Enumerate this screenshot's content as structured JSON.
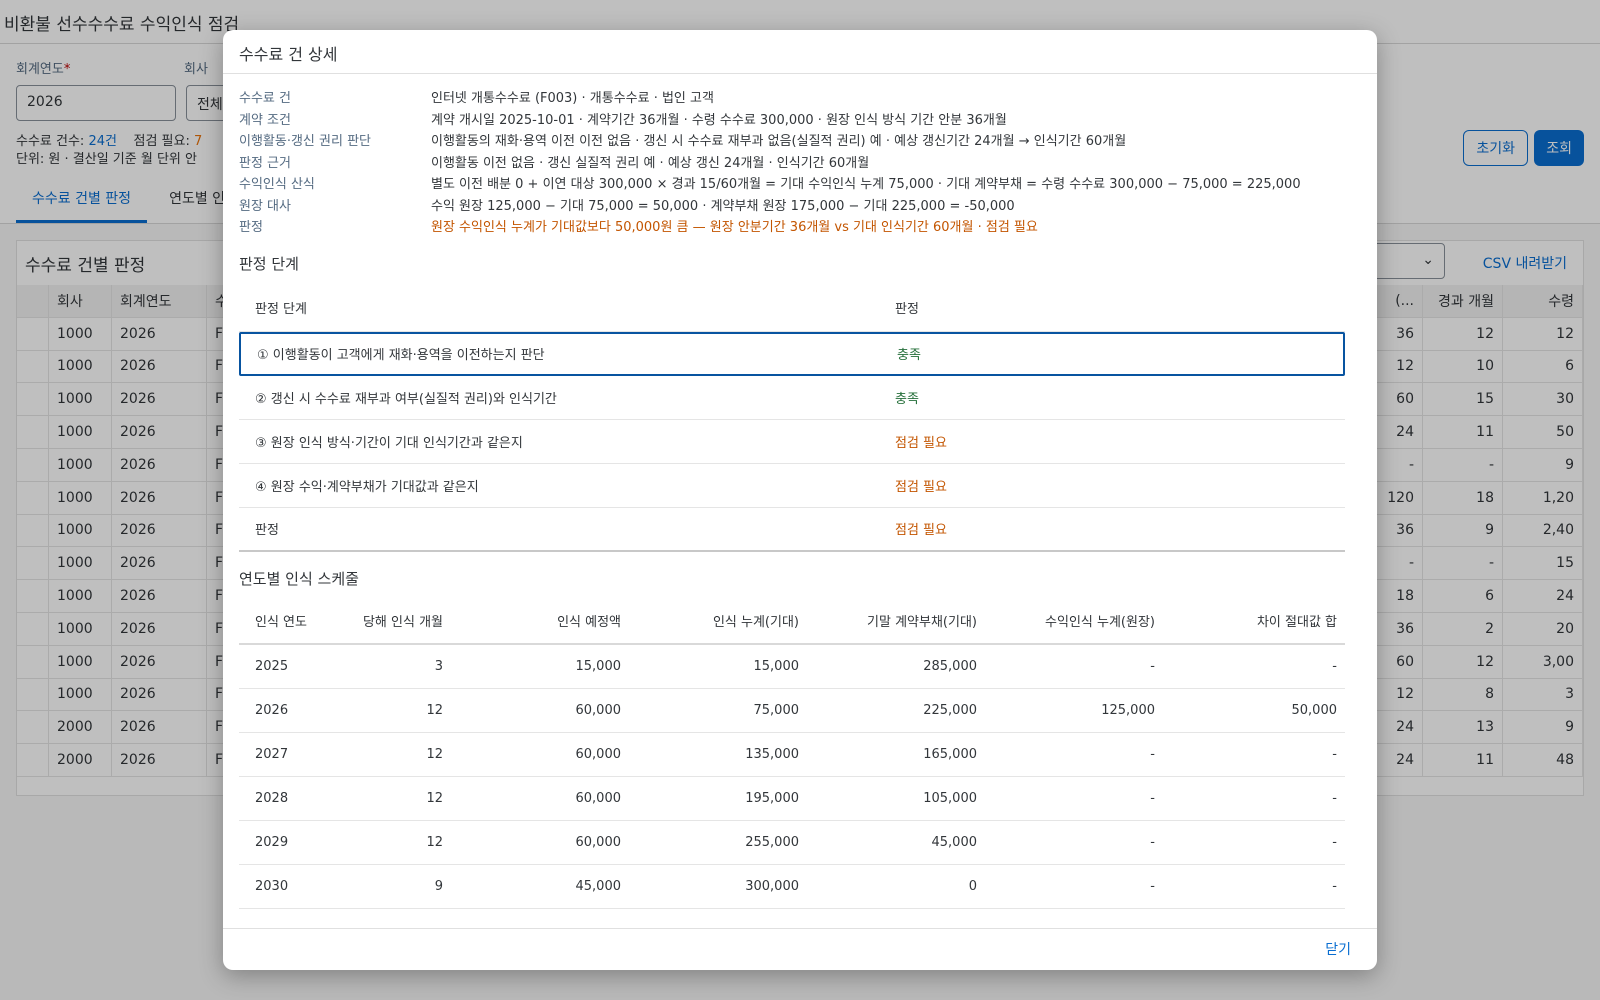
{
  "page": {
    "title": "비환불 선수수수료 수익인식 점검",
    "filters": {
      "fiscal_year_label": "회계연도",
      "required_mark": "*",
      "fiscal_year_value": "2026",
      "company_label": "회사",
      "company_value": "전체"
    },
    "summary": {
      "count_label": "수수료 건수:",
      "count_value": "24건",
      "check_label": "점검 필요:",
      "check_value": "7",
      "unit_note": "단위: 원 · 결산일 기준 월 단위 안"
    },
    "buttons": {
      "reset": "초기화",
      "search": "조회"
    },
    "tabs": [
      {
        "label": "수수료 건별 판정"
      },
      {
        "label": "연도별 인"
      }
    ],
    "panel": {
      "title": "수수료 건별 판정",
      "csv": "CSV 내려받기",
      "columns": {
        "company": "회사",
        "fiscal_year": "회계연도",
        "fee": "수",
        "period": "(...",
        "elapsed": "경과 개월",
        "received": "수령"
      },
      "rows": [
        {
          "company": "1000",
          "fy": "2026",
          "f": "F",
          "p": "36",
          "e": "12",
          "r": "12"
        },
        {
          "company": "1000",
          "fy": "2026",
          "f": "F",
          "p": "12",
          "e": "10",
          "r": "6"
        },
        {
          "company": "1000",
          "fy": "2026",
          "f": "F",
          "p": "60",
          "e": "15",
          "r": "30"
        },
        {
          "company": "1000",
          "fy": "2026",
          "f": "F",
          "p": "24",
          "e": "11",
          "r": "50"
        },
        {
          "company": "1000",
          "fy": "2026",
          "f": "F",
          "p": "-",
          "e": "-",
          "r": "9"
        },
        {
          "company": "1000",
          "fy": "2026",
          "f": "F",
          "p": "120",
          "e": "18",
          "r": "1,20"
        },
        {
          "company": "1000",
          "fy": "2026",
          "f": "F",
          "p": "36",
          "e": "9",
          "r": "2,40"
        },
        {
          "company": "1000",
          "fy": "2026",
          "f": "F",
          "p": "-",
          "e": "-",
          "r": "15"
        },
        {
          "company": "1000",
          "fy": "2026",
          "f": "F",
          "p": "18",
          "e": "6",
          "r": "24"
        },
        {
          "company": "1000",
          "fy": "2026",
          "f": "F",
          "p": "36",
          "e": "2",
          "r": "20"
        },
        {
          "company": "1000",
          "fy": "2026",
          "f": "F",
          "p": "60",
          "e": "12",
          "r": "3,00"
        },
        {
          "company": "1000",
          "fy": "2026",
          "f": "F",
          "p": "12",
          "e": "8",
          "r": "3"
        },
        {
          "company": "2000",
          "fy": "2026",
          "f": "F",
          "p": "24",
          "e": "13",
          "r": "9"
        },
        {
          "company": "2000",
          "fy": "2026",
          "f": "F",
          "p": "24",
          "e": "11",
          "r": "48"
        }
      ]
    }
  },
  "dialog": {
    "title": "수수료 건 상세",
    "info": [
      {
        "key": "수수료 건",
        "value": "인터넷 개통수수료 (F003) · 개통수수료 · 법인 고객",
        "tone": "normal"
      },
      {
        "key": "계약 조건",
        "value": "계약 개시일 2025-10-01 · 계약기간 36개월 · 수령 수수료 300,000 · 원장 인식 방식 기간 안분 36개월",
        "tone": "normal"
      },
      {
        "key": "이행활동·갱신 권리 판단",
        "value": "이행활동의 재화·용역 이전 이전 없음 · 갱신 시 수수료 재부과 없음(실질적 권리) 예 · 예상 갱신기간 24개월 → 인식기간 60개월",
        "tone": "normal"
      },
      {
        "key": "판정 근거",
        "value": "이행활동 이전 없음 · 갱신 실질적 권리 예 · 예상 갱신 24개월 · 인식기간 60개월",
        "tone": "normal"
      },
      {
        "key": "수익인식 산식",
        "value": "별도 이전 배분 0 + 이연 대상 300,000 × 경과 15/60개월 = 기대 수익인식 누계 75,000 · 기대 계약부채 = 수령 수수료 300,000 − 75,000 = 225,000",
        "tone": "normal"
      },
      {
        "key": "원장 대사",
        "value": "수익 원장 125,000 − 기대 75,000 = 50,000 · 계약부채 원장 175,000 − 기대 225,000 = -50,000",
        "tone": "normal"
      },
      {
        "key": "판정",
        "value": "원장 수익인식 누계가 기대값보다 50,000원 큼 — 원장 안분기간 36개월 vs 기대 인식기간 60개월 · 점검 필요",
        "tone": "warn"
      }
    ],
    "steps_title": "판정 단계",
    "steps_header": {
      "step": "판정 단계",
      "result": "판정"
    },
    "steps": [
      {
        "step": "① 이행활동이 고객에게 재화·용역을 이전하는지 판단",
        "result": "충족",
        "status": "ok"
      },
      {
        "step": "② 갱신 시 수수료 재부과 여부(실질적 권리)와 인식기간",
        "result": "충족",
        "status": "ok"
      },
      {
        "step": "③ 원장 인식 방식·기간이 기대 인식기간과 같은지",
        "result": "점검 필요",
        "status": "check"
      },
      {
        "step": "④ 원장 수익·계약부채가 기대값과 같은지",
        "result": "점검 필요",
        "status": "check"
      },
      {
        "step": "판정",
        "result": "점검 필요",
        "status": "check"
      }
    ],
    "schedule_title": "연도별 인식 스케줄",
    "schedule_header": {
      "year": "인식 연도",
      "months": "당해 인식 개월",
      "amount": "인식 예정액",
      "cum": "인식 누계(기대)",
      "liability": "기말 계약부채(기대)",
      "ledger": "수익인식 누계(원장)",
      "diff": "차이 절대값 합"
    },
    "schedule": [
      {
        "year": "2025",
        "months": "3",
        "amount": "15,000",
        "cum": "15,000",
        "liability": "285,000",
        "ledger": "-",
        "diff": "-"
      },
      {
        "year": "2026",
        "months": "12",
        "amount": "60,000",
        "cum": "75,000",
        "liability": "225,000",
        "ledger": "125,000",
        "diff": "50,000"
      },
      {
        "year": "2027",
        "months": "12",
        "amount": "60,000",
        "cum": "135,000",
        "liability": "165,000",
        "ledger": "-",
        "diff": "-"
      },
      {
        "year": "2028",
        "months": "12",
        "amount": "60,000",
        "cum": "195,000",
        "liability": "105,000",
        "ledger": "-",
        "diff": "-"
      },
      {
        "year": "2029",
        "months": "12",
        "amount": "60,000",
        "cum": "255,000",
        "liability": "45,000",
        "ledger": "-",
        "diff": "-"
      },
      {
        "year": "2030",
        "months": "9",
        "amount": "45,000",
        "cum": "300,000",
        "liability": "0",
        "ledger": "-",
        "diff": "-"
      }
    ],
    "close": "닫기"
  }
}
